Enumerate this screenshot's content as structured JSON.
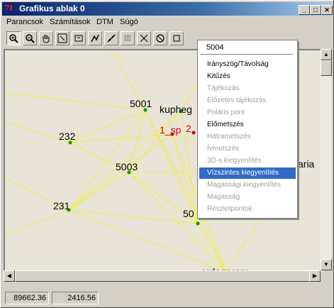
{
  "window": {
    "title": "Grafikus ablak 0",
    "icon_label": "7i"
  },
  "menu": [
    "Parancsok",
    "Számítások",
    "DTM",
    "Súgó"
  ],
  "toolbar": [
    "zoom-in-icon",
    "zoom-out-icon",
    "hand-pan-icon",
    "zoom-extents-icon",
    "zoom-window-icon",
    "measure-icon",
    "line-tool-icon",
    "grid-tool-icon",
    "cross-tool-icon",
    "refresh-icon",
    "blank-icon"
  ],
  "map": {
    "points": [
      {
        "label": "5001",
        "color": "#000000"
      },
      {
        "label": "kupheg",
        "color": "#000000"
      },
      {
        "label": "232",
        "color": "#000000"
      },
      {
        "label": "1_sp",
        "color": "#e00000"
      },
      {
        "label": "2",
        "color": "#e00000"
      },
      {
        "label": "5003",
        "color": "#000000"
      },
      {
        "label": "aria",
        "color": "#000000"
      },
      {
        "label": "231",
        "color": "#000000"
      },
      {
        "label": "50",
        "color": "#000000"
      },
      {
        "label": "ordogorom",
        "color": "#000000"
      }
    ],
    "line_color": "#f0f040"
  },
  "context_menu": {
    "header": "5004",
    "items": [
      {
        "label": "Irányszög/Távolság",
        "state": "enabled"
      },
      {
        "label": "Kitűzés",
        "state": "enabled"
      },
      {
        "label": "Tájékozás",
        "state": "disabled"
      },
      {
        "label": "Előzetes tájékozás",
        "state": "disabled"
      },
      {
        "label": "Poláris pont",
        "state": "disabled"
      },
      {
        "label": "Előmetszés",
        "state": "enabled"
      },
      {
        "label": "Hátrametszés",
        "state": "disabled"
      },
      {
        "label": "Ívmetszés",
        "state": "disabled"
      },
      {
        "label": "3D-s kiegyenlítés",
        "state": "disabled"
      },
      {
        "label": "Vízszintes kiegyenlítés",
        "state": "selected"
      },
      {
        "label": "Magassági kiegyenlítés",
        "state": "disabled"
      },
      {
        "label": "Magasság",
        "state": "disabled"
      },
      {
        "label": "Részletpontok",
        "state": "disabled"
      }
    ]
  },
  "status": {
    "x": "89662.36",
    "y": "2416.56"
  }
}
